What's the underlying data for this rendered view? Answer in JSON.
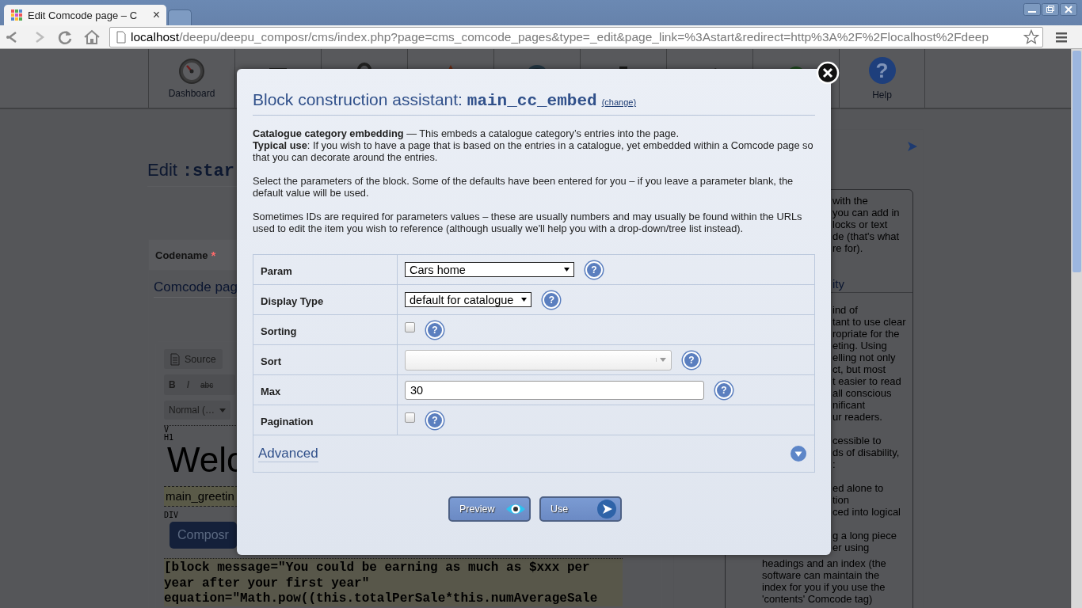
{
  "browser": {
    "tabs": [
      {
        "title": "Edit Comcode page – C",
        "close": "×",
        "selected": true
      },
      {
        "selected": false
      }
    ],
    "address": {
      "host": "localhost",
      "path": "/deepu/deepu_composr/cms/index.php?page=cms_comcode_pages&type=_edit&page_link=%3Astart&redirect=http%3A%2F%2Flocalhost%2Fdeep"
    }
  },
  "nav": [
    {
      "kind": "gauge",
      "label": "Dashboard"
    },
    {
      "kind": "menu"
    },
    {
      "kind": "lock"
    },
    {
      "kind": "warning"
    },
    {
      "kind": "globe"
    },
    {
      "kind": "clipboard"
    },
    {
      "kind": "hammer"
    },
    {
      "kind": "update"
    },
    {
      "kind": "help",
      "glyph": "?",
      "label": "Help"
    }
  ],
  "page": {
    "heading": "Edit",
    "heading_code": ":star",
    "form": {
      "label": "Codename",
      "required_mark": "*",
      "link": "Comcode pag"
    },
    "editor": {
      "source_button": "Source",
      "format_buttons": [
        "B",
        "I",
        "abc"
      ],
      "style_select": "Normal (…",
      "tags": [
        "V",
        "H1"
      ],
      "heading": "Welc",
      "block": "main_greetin",
      "div_tag": "DIV",
      "button": "Composr",
      "code_lines": [
        "[block message=\"You could be earning as much as $xxx per",
        "year after your first year\"",
        "equation=\"Math.pow((this.totalPerSale*this.numAverageSale"
      ]
    }
  },
  "sidebar": {
    "blocks": [
      {
        "kind": "para",
        "lines": [
          {
            "text": "with the",
            "kind": "fragment"
          },
          {
            "text": "you can add in",
            "kind": "fragment"
          },
          {
            "text": "locks or text",
            "kind": "fragment"
          },
          {
            "text": "de (that's what",
            "kind": "fragment"
          },
          {
            "text": "re for).",
            "kind": "fragment"
          }
        ]
      },
      {
        "kind": "heading",
        "lines": [
          {
            "text": "ity",
            "kind": "fragment"
          }
        ]
      },
      {
        "kind": "para",
        "lines": [
          {
            "text": "ind of",
            "kind": "fragment"
          },
          {
            "text": "tant to use clear",
            "kind": "fragment"
          },
          {
            "text": "ropriate for the",
            "kind": "fragment"
          },
          {
            "text": "eting. Using",
            "kind": "fragment"
          },
          {
            "text": "elling not only",
            "kind": "fragment"
          },
          {
            "text": "ct, but most",
            "kind": "fragment"
          },
          {
            "text": "t easier to read",
            "kind": "fragment"
          },
          {
            "text": "all conscious",
            "kind": "fragment"
          },
          {
            "text": "nificant",
            "kind": "fragment"
          },
          {
            "text": "ur readers.",
            "kind": "fragment"
          }
        ]
      },
      {
        "kind": "para",
        "lines": [
          {
            "text": "cessible to",
            "kind": "fragment"
          },
          {
            "text": "ds of disability,",
            "kind": "fragment"
          },
          {
            "text": ":",
            "kind": "fragment"
          }
        ]
      },
      {
        "kind": "para",
        "lines": [
          {
            "text": "ed alone to",
            "kind": "fragment"
          },
          {
            "text": "tion",
            "kind": "fragment"
          },
          {
            "text": "ced into logical",
            "kind": "fragment"
          }
        ]
      },
      {
        "kind": "para",
        "lines": [
          {
            "text": "g a long piece",
            "kind": "fragment"
          },
          {
            "text": "er using",
            "kind": "fragment"
          },
          {
            "text": "headings and an index (the",
            "kind": "full"
          },
          {
            "text": "software can maintain the",
            "kind": "full"
          },
          {
            "text": "index for you if you use the",
            "kind": "full"
          },
          {
            "text": "'contents' Comcode tag)",
            "kind": "full"
          }
        ]
      }
    ]
  },
  "modal": {
    "title": "Block construction assistant: ",
    "block_name": "main_cc_embed",
    "change_link": "(change)",
    "intro": [
      "**Catalogue category embedding** — This embeds a catalogue category’s entries into the page.",
      "**Typical use**: If you wish to have a page that is based on the entries in a catalogue, yet embedded within a Comcode page so that you can decorate around the entries."
    ],
    "paragraphs": [
      "Select the parameters of the block. Some of the defaults have been entered for you – if you leave a parameter blank, the default value will be used.",
      "Sometimes IDs are required for parameters values – these are usually numbers and may usually be found within the URLs used to edit the item you wish to reference (although usually we'll help you with a drop-down/tree list instead)."
    ],
    "fields": [
      {
        "kind": "select",
        "label": "Param",
        "value": "Cars home",
        "help": "?"
      },
      {
        "kind": "select",
        "label": "Display Type",
        "value": "default for catalogue",
        "help": "?"
      },
      {
        "kind": "checkbox",
        "label": "Sorting",
        "checked": false,
        "help": "?"
      },
      {
        "kind": "combo",
        "label": "Sort",
        "help": "?"
      },
      {
        "kind": "text",
        "label": "Max",
        "value": "30",
        "help": "?"
      },
      {
        "kind": "checkbox",
        "label": "Pagination",
        "checked": false,
        "help": "?"
      }
    ],
    "advanced": {
      "label": "Advanced",
      "expanded": false
    },
    "buttons": [
      {
        "kind": "preview",
        "label": "Preview"
      },
      {
        "kind": "use",
        "label": "Use"
      }
    ]
  }
}
